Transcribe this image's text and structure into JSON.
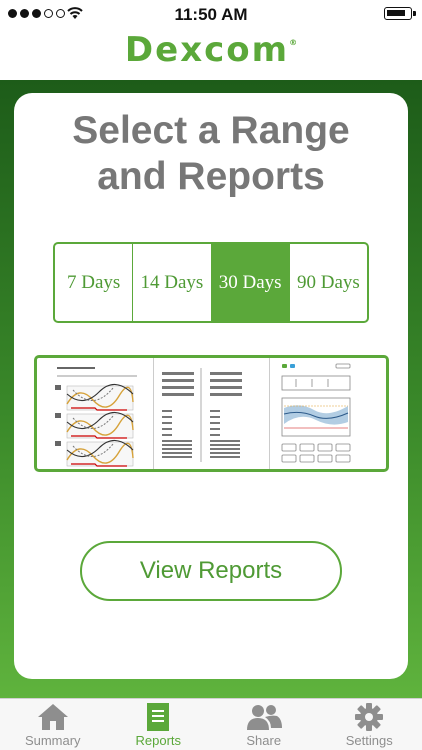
{
  "status_bar": {
    "time": "11:50 AM",
    "signal_bars_filled": 3,
    "signal_bars_total": 5
  },
  "header": {
    "logo_text": "Dexcom",
    "logo_mark": "®"
  },
  "main": {
    "title_line1": "Select a Range",
    "title_line2": "and Reports",
    "ranges": [
      {
        "label": "7 Days",
        "selected": false
      },
      {
        "label": "14 Days",
        "selected": false
      },
      {
        "label": "30 Days",
        "selected": true
      },
      {
        "label": "90 Days",
        "selected": false
      }
    ],
    "report_previews": [
      "patterns-report-icon",
      "statistics-report-icon",
      "overview-report-icon"
    ],
    "view_reports_label": "View Reports"
  },
  "tabbar": {
    "tabs": [
      {
        "label": "Summary",
        "icon": "home-icon",
        "active": false
      },
      {
        "label": "Reports",
        "icon": "reports-icon",
        "active": true
      },
      {
        "label": "Share",
        "icon": "share-icon",
        "active": false
      },
      {
        "label": "Settings",
        "icon": "gear-icon",
        "active": false
      }
    ]
  },
  "colors": {
    "brand_green": "#5ba83a",
    "title_gray": "#777777",
    "inactive_tab": "#8e8e8e"
  }
}
